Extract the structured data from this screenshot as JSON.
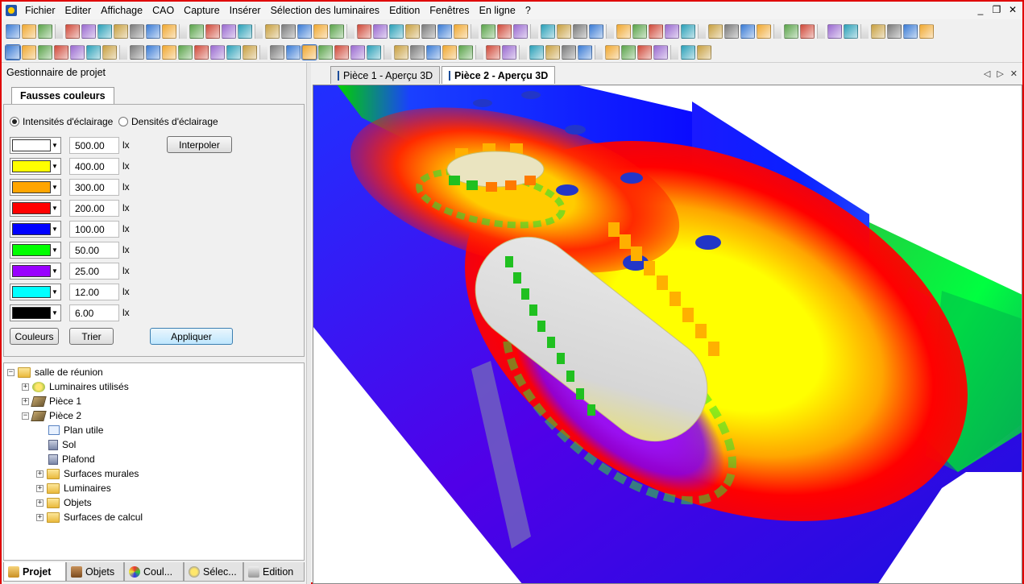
{
  "menu": {
    "items": [
      "Fichier",
      "Editer",
      "Affichage",
      "CAO",
      "Capture",
      "Insérer",
      "Sélection des luminaires",
      "Edition",
      "Fenêtres",
      "En ligne",
      "?"
    ]
  },
  "window_controls": {
    "minimize": "_",
    "restore": "❐",
    "close": "✕"
  },
  "toolbar_row1_icons": [
    "new-doc",
    "open",
    "save",
    "print",
    "print-preview",
    "pdf",
    "cut",
    "copy",
    "paste",
    "undo",
    "room-3d",
    "l-room",
    "room-3d-b",
    "room-3d-c",
    "cuboid",
    "zoom-fit",
    "link",
    "unlink",
    "chain",
    "cube-outline",
    "cube-edit",
    "color-bar",
    "edit-a",
    "edit-b",
    "edit-c",
    "planner-card",
    "target",
    "sphere",
    "light-arrow",
    "light-arrow-b",
    "stairs",
    "box-texture",
    "box-edit",
    "quill",
    "palette-box",
    "shape-a",
    "shape-b",
    "shape-c",
    "shape-d",
    "shape-e",
    "texture-frame",
    "frame",
    "tools",
    "hierarchy",
    "network",
    "line",
    "polyline",
    "curve",
    "circle",
    "polygon"
  ],
  "toolbar_row2_icons": [
    "select-lum-a",
    "select-lum-b",
    "select-lum-c",
    "select-lum-d",
    "select-lum-e",
    "select-lum-f",
    "select-lum-g",
    "grid-red",
    "triangle-red",
    "grid-red-b",
    "dxf",
    "grid-grey",
    "grid-grey-b",
    "grid-grey-c",
    "grid-grey-d",
    "pointer",
    "zoom",
    "rotate-view",
    "hand",
    "magnify-dots",
    "move-arrows",
    "stack",
    "calendar",
    "hide",
    "page",
    "key",
    "film",
    "align-a",
    "align-b",
    "align-c",
    "align-d",
    "align-e",
    "align-f",
    "align-g",
    "align-h",
    "align-i",
    "align-j",
    "align-k",
    "align-l"
  ],
  "project_manager": {
    "title": "Gestionnaire de projet",
    "tab": "Fausses couleurs",
    "radio_intensity": "Intensités d'éclairage",
    "radio_density": "Densités d'éclairage",
    "selected_mode": "intensity",
    "levels": [
      {
        "color": "#ffffff",
        "value": "500.00",
        "unit": "lx"
      },
      {
        "color": "#ffff00",
        "value": "400.00",
        "unit": "lx"
      },
      {
        "color": "#ffa500",
        "value": "300.00",
        "unit": "lx"
      },
      {
        "color": "#ff0000",
        "value": "200.00",
        "unit": "lx"
      },
      {
        "color": "#0000ff",
        "value": "100.00",
        "unit": "lx"
      },
      {
        "color": "#00ff00",
        "value": "50.00",
        "unit": "lx"
      },
      {
        "color": "#9900ff",
        "value": "25.00",
        "unit": "lx"
      },
      {
        "color": "#00ffff",
        "value": "12.00",
        "unit": "lx"
      },
      {
        "color": "#000000",
        "value": "6.00",
        "unit": "lx"
      }
    ],
    "buttons": {
      "interpolate": "Interpoler",
      "colors": "Couleurs",
      "sort": "Trier",
      "apply": "Appliquer"
    }
  },
  "tree": {
    "root": "salle de réunion",
    "used_luminaires": "Luminaires utilisés",
    "room1": "Pièce 1",
    "room2": "Pièce 2",
    "room2_children": [
      "Plan utile",
      "Sol",
      "Plafond",
      "Surfaces murales",
      "Luminaires",
      "Objets",
      "Surfaces de calcul"
    ]
  },
  "bottom_tabs": [
    "Projet",
    "Objets",
    "Coul...",
    "Sélec...",
    "Edition"
  ],
  "bottom_tabs_active": 0,
  "doc_tabs": [
    "Pièce 1 - Aperçu 3D",
    "Pièce 2 - Aperçu 3D"
  ],
  "doc_tabs_active": 1,
  "doc_nav": [
    "◁",
    "▷",
    "✕"
  ]
}
